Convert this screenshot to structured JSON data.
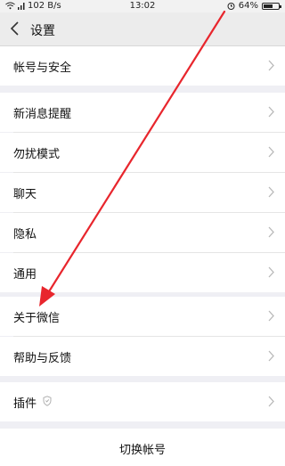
{
  "status_bar": {
    "signal_text": "..l",
    "speed": "102 B/s",
    "time": "13:02",
    "battery": "64%",
    "battery_level": 0.64,
    "icons": [
      "signal-icon",
      "wifi-icon",
      "alarm-icon",
      "battery-icon"
    ]
  },
  "header": {
    "back_icon": "chevron-left-icon",
    "title": "设置"
  },
  "settings": {
    "account_security": "帐号与安全",
    "new_message_alert": "新消息提醒",
    "do_not_disturb": "勿扰模式",
    "chat": "聊天",
    "privacy": "隐私",
    "general": "通用",
    "about_wechat": "关于微信",
    "help_feedback": "帮助与反馈",
    "plugins": "插件",
    "switch_account": "切换帐号"
  },
  "annotation": {
    "color": "#e8262d",
    "target": "about_wechat"
  },
  "colors": {
    "background": "#efeff4",
    "row": "#ffffff",
    "chevron": "#b8b8b8"
  }
}
